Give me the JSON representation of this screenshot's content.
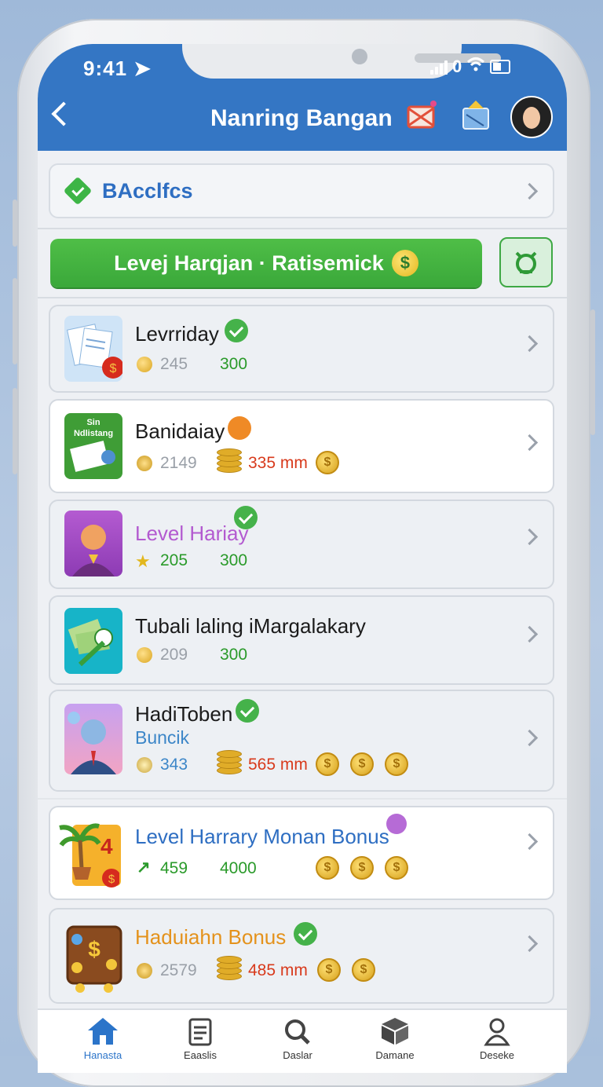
{
  "status_bar": {
    "time": "9:41",
    "signal_text": "0"
  },
  "header": {
    "title": "Nanring Bangan"
  },
  "basics": {
    "label": "BAcclfcs"
  },
  "banner": {
    "label": "Levej Harqjan · Ratisemick",
    "coin_symbol": "$"
  },
  "items": [
    {
      "title": "Levrriday",
      "sub": "",
      "stat1": "245",
      "stat2": "300",
      "stat2_color": "#2a9a2a",
      "badge": "check-green"
    },
    {
      "title": "Banidaiay",
      "sub": "",
      "stat1": "2149",
      "stat2": "335 mm",
      "stat2_color": "#d83a1c",
      "badge": "orange"
    },
    {
      "title": "Level Hariay",
      "sub": "",
      "stat1": "205",
      "stat2": "300",
      "stat2_color": "#2a9a2a",
      "badge": "check-green"
    },
    {
      "title": "Tubali laling iMargalakary",
      "sub": "",
      "stat1": "209",
      "stat2": "300",
      "stat2_color": "#2a9a2a",
      "badge": ""
    },
    {
      "title": "HadiToben",
      "sub": "Buncik",
      "stat1": "343",
      "stat2": "565 mm",
      "stat2_color": "#d83a1c",
      "badge": "check-green"
    },
    {
      "title": "Level Harrary Monan Bonus",
      "sub": "",
      "stat1": "459",
      "stat2": "4000",
      "stat2_color": "#2a9a2a",
      "badge": "purple"
    },
    {
      "title": "Haduiahn Bonus",
      "sub": "",
      "stat1": "2579",
      "stat2": "485 mm",
      "stat2_color": "#d83a1c",
      "badge": "check-green"
    }
  ],
  "thumb_text": {
    "item2_line1": "Sin",
    "item2_line2": "Ndlistang",
    "item6_number": "4"
  },
  "nav": [
    {
      "label": "Hanasta",
      "icon": "home-icon"
    },
    {
      "label": "Eaaslis",
      "icon": "clipboard-icon"
    },
    {
      "label": "Daslar",
      "icon": "search-icon"
    },
    {
      "label": "Damane",
      "icon": "box-icon"
    },
    {
      "label": "Deseke",
      "icon": "profile-icon"
    }
  ],
  "colors": {
    "header": "#3476c4",
    "accent_green": "#3db546",
    "coin_gold": "#e2b71e"
  }
}
